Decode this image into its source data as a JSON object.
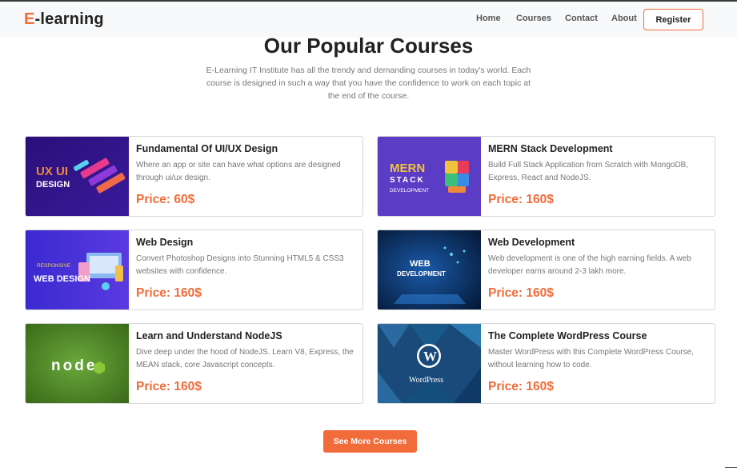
{
  "nav": {
    "brand_prefix": "E",
    "brand_rest": "-learning",
    "links": [
      "Home",
      "Courses",
      "Contact",
      "About"
    ],
    "register": "Register"
  },
  "section": {
    "title": "Our Popular Courses",
    "intro": "E-Learning IT Institute has all the trendy and demanding courses in today's world. Each course is designed in such a way that you have the confidence to work on each topic at the end of the course."
  },
  "courses": [
    {
      "title": "Fundamental Of UI/UX Design",
      "desc": "Where an app or site can have what options are designed through ui/ux design.",
      "price": "Price: 60$",
      "thumb_lines": [
        "UX UI",
        "DESIGN"
      ]
    },
    {
      "title": "MERN Stack Development",
      "desc": "Build Full Stack Application from Scratch with MongoDB, Express, React and NodeJS.",
      "price": "Price: 160$",
      "thumb_lines": [
        "MERN",
        "STACK",
        "DEVELOPMENT"
      ]
    },
    {
      "title": "Web Design",
      "desc": "Convert Photoshop Designs into Stunning HTML5 & CSS3 websites with confidence.",
      "price": "Price: 160$",
      "thumb_lines": [
        "RESPONSIVE",
        "WEB DESIGN"
      ]
    },
    {
      "title": "Web Development",
      "desc": "Web development is one of the high earning fields. A web developer earns around 2-3 lakh more.",
      "price": "Price: 160$",
      "thumb_lines": [
        "WEB",
        "DEVELOPMENT"
      ]
    },
    {
      "title": "Learn and Understand NodeJS",
      "desc": "Dive deep under the hood of NodeJS. Learn V8, Express, the MEAN stack, core Javascript concepts.",
      "price": "Price: 160$",
      "thumb_lines": [
        "node"
      ]
    },
    {
      "title": "The Complete WordPress Course",
      "desc": "Master WordPress with this Complete WordPress Course, without learning how to code.",
      "price": "Price: 160$",
      "thumb_lines": [
        "WordPress"
      ]
    }
  ],
  "more_button": "See More Courses",
  "colors": {
    "accent": "#f26b3a",
    "text": "#222222",
    "muted": "#777777"
  }
}
